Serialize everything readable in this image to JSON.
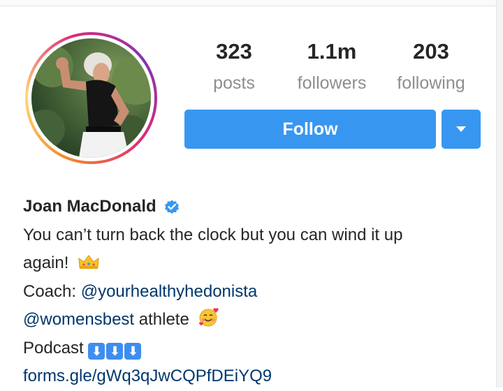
{
  "profile": {
    "stats": [
      {
        "value": "323",
        "label": "posts"
      },
      {
        "value": "1.1m",
        "label": "followers"
      },
      {
        "value": "203",
        "label": "following"
      }
    ],
    "follow_label": "Follow",
    "name": "Joan MacDonald",
    "bio": {
      "line1": "You can’t turn back the clock but you can wind it up",
      "line2": "again!",
      "coach_prefix": "Coach: ",
      "coach_handle": "@yourhealthyhedonista",
      "brand_handle": "@womensbest",
      "athlete_text": " athlete",
      "podcast_label": "Podcast ",
      "arrow_glyph": "⬇",
      "link": "forms.gle/gWq3qJwCQPfDEiYQ9"
    }
  },
  "colors": {
    "accent": "#3797f0",
    "link": "#00376b",
    "verified": "#3897f0"
  },
  "icons": {
    "verified": "verified-badge-icon",
    "crown": "crown-emoji",
    "smile": "smiling-face-with-hearts-emoji",
    "caret": "caret-down-icon",
    "arrow": "down-arrow-emoji"
  }
}
